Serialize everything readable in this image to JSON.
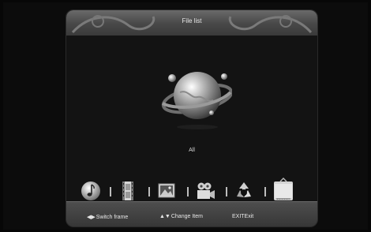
{
  "window": {
    "title": "File list"
  },
  "selected_category": {
    "label": "All"
  },
  "categories": [
    {
      "icon": "music-note-icon"
    },
    {
      "icon": "film-strip-icon"
    },
    {
      "icon": "picture-icon"
    },
    {
      "icon": "video-camera-icon"
    },
    {
      "icon": "recycle-arrows-icon"
    },
    {
      "icon": "tv-folder-icon",
      "selected": true
    }
  ],
  "footer": {
    "switch_frame": {
      "glyph": "◀▶",
      "label": "Switch frame"
    },
    "change_item": {
      "glyph": "▲▼",
      "label": "Change Item"
    },
    "exit": {
      "label": "EXITExit"
    }
  },
  "colors": {
    "background": "#070707",
    "panel": "#131313",
    "header": "#5a5a5a",
    "text": "#e6e6e6"
  }
}
